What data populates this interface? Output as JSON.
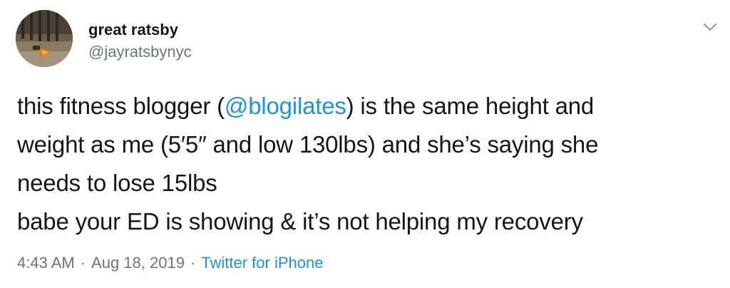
{
  "author": {
    "display_name": "great ratsby",
    "handle": "@jayratsbynyc",
    "avatar_icon": "avatar-photo"
  },
  "menu": {
    "icon": "chevron-down-icon"
  },
  "tweet": {
    "line1_before": "this fitness blogger (",
    "mention": "@blogilates",
    "line1_after": ") is the same height and",
    "line2": "weight as me (5′5″ and low 130lbs) and she’s saying she",
    "line3": "needs to lose 15lbs",
    "line4": "babe your ED is showing & it’s not helping my recovery"
  },
  "meta": {
    "time": "4:43 AM",
    "separator": "·",
    "date": "Aug 18, 2019",
    "source": "Twitter for iPhone"
  },
  "colors": {
    "text": "#14171a",
    "secondary": "#657786",
    "link": "#1b95e0"
  }
}
